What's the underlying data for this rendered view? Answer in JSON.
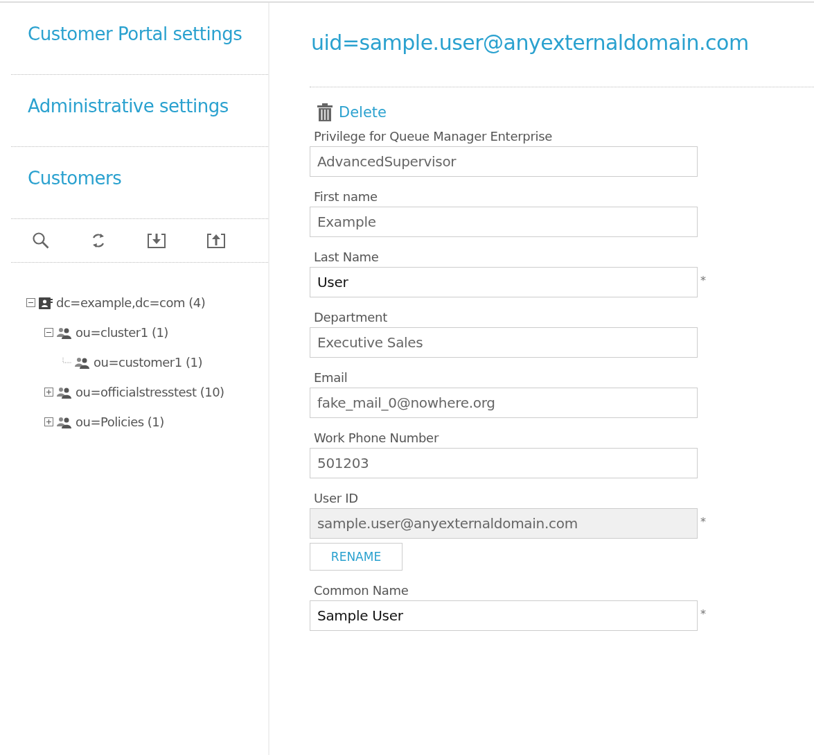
{
  "sidebar": {
    "sections": [
      {
        "title": "Customer Portal settings"
      },
      {
        "title": "Administrative settings"
      },
      {
        "title": "Customers"
      }
    ],
    "toolbar": [
      {
        "kind": "search"
      },
      {
        "kind": "refresh"
      },
      {
        "kind": "import"
      },
      {
        "kind": "export"
      }
    ],
    "tree": [
      {
        "label": "dc=example,dc=com (4)",
        "kind": "domain",
        "expandable": true,
        "expanded": true,
        "children": [
          {
            "label": "ou=cluster1 (1)",
            "kind": "group",
            "expandable": true,
            "expanded": true,
            "children": [
              {
                "label": "ou=customer1 (1)",
                "kind": "group",
                "expandable": false,
                "expanded": false
              }
            ]
          },
          {
            "label": "ou=officialstresstest (10)",
            "kind": "group",
            "expandable": true,
            "expanded": false
          },
          {
            "label": "ou=Policies (1)",
            "kind": "group",
            "expandable": true,
            "expanded": false
          }
        ]
      }
    ]
  },
  "main": {
    "title": "uid=sample.user@anyexternaldomain.com",
    "delete_label": "Delete",
    "fields": [
      {
        "label": "Privilege for Queue Manager Enterprise",
        "value": "AdvancedSupervisor",
        "disabled": false
      },
      {
        "label": "First name",
        "value": "Example",
        "disabled": false
      },
      {
        "label": "Last Name",
        "value": "User",
        "disabled": false,
        "marker": "*"
      },
      {
        "label": "Department",
        "value": "Executive Sales",
        "disabled": false
      },
      {
        "label": "Email",
        "value": "fake_mail_0@nowhere.org",
        "disabled": false
      },
      {
        "label": "Work Phone Number",
        "value": "501203",
        "disabled": false
      },
      {
        "label": "User ID",
        "value": "sample.user@anyexternaldomain.com",
        "disabled": true,
        "marker": "*",
        "button": "RENAME"
      },
      {
        "label": "Common Name",
        "value": "Sample User",
        "disabled": false,
        "marker": "*"
      }
    ]
  }
}
